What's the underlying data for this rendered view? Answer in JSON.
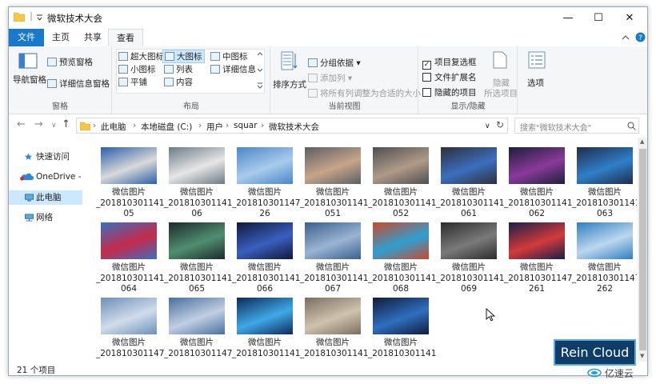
{
  "window": {
    "title": "微软技术大会",
    "minimize": "—",
    "maximize": "☐",
    "close": "✕"
  },
  "ribbon_tabs": [
    "文件",
    "主页",
    "共享",
    "查看"
  ],
  "ribbon": {
    "pane_group": {
      "label": "窗格",
      "nav_pane": "导航窗格",
      "preview_pane": "预览窗格",
      "details_pane": "详细信息窗格"
    },
    "layout_group": {
      "label": "布局",
      "items": [
        "超大图标",
        "大图标",
        "中图标",
        "小图标",
        "列表",
        "详细信息",
        "平铺",
        "内容"
      ],
      "selected": "大图标"
    },
    "view_group": {
      "label": "当前视图",
      "sort": "排序方式",
      "group_by": "分组依据",
      "add_column": "添加列",
      "fit_columns": "将所有列调整为合适的大小"
    },
    "showhide_group": {
      "label": "显示/隐藏",
      "checkboxes": [
        {
          "label": "项目复选框",
          "checked": true
        },
        {
          "label": "文件扩展名",
          "checked": false
        },
        {
          "label": "隐藏的项目",
          "checked": false
        }
      ],
      "hide_selected_line1": "隐藏",
      "hide_selected_line2": "所选项目",
      "options": "选项"
    }
  },
  "address": {
    "crumbs": [
      "此电脑",
      "本地磁盘 (C:)",
      "用户",
      "squar",
      "微软技术大会"
    ],
    "search_placeholder": "搜索\"微软技术大会\""
  },
  "nav_pane": [
    {
      "label": "快速访问",
      "selected": false
    },
    {
      "label": "OneDrive -",
      "selected": false
    },
    {
      "label": "此电脑",
      "selected": true
    },
    {
      "label": "网络",
      "selected": false
    }
  ],
  "files": [
    {
      "line1": "微信图片",
      "line2": "_201810301141",
      "line3": "05",
      "colors": [
        "#2a5fa8",
        "#d9d9d9"
      ]
    },
    {
      "line1": "微信图片",
      "line2": "_201810301141",
      "line3": "06",
      "colors": [
        "#6b7b86",
        "#e6e6e6"
      ]
    },
    {
      "line1": "微信图片",
      "line2": "_201810301147",
      "line3": "26",
      "colors": [
        "#4a86c8",
        "#a9cbec"
      ]
    },
    {
      "line1": "微信图片",
      "line2": "_201810301141",
      "line3": "051",
      "colors": [
        "#5c5f63",
        "#c8a48a"
      ]
    },
    {
      "line1": "微信图片",
      "line2": "_201810301141",
      "line3": "052",
      "colors": [
        "#4d4f52",
        "#b09a88"
      ]
    },
    {
      "line1": "微信图片",
      "line2": "_201810301141",
      "line3": "061",
      "colors": [
        "#2f2f3a",
        "#3b6fbf"
      ]
    },
    {
      "line1": "微信图片",
      "line2": "_201810301141",
      "line3": "062",
      "colors": [
        "#1c1f3b",
        "#8a3a9a"
      ]
    },
    {
      "line1": "微信图片",
      "line2": "_201810301141",
      "line3": "063",
      "colors": [
        "#1f2d4a",
        "#2f7fc9"
      ]
    },
    {
      "line1": "微信图片",
      "line2": "_201810301141",
      "line3": "064",
      "colors": [
        "#3a6fbf",
        "#c52b4a"
      ]
    },
    {
      "line1": "微信图片",
      "line2": "_201810301141",
      "line3": "065",
      "colors": [
        "#1c2a2e",
        "#4f8f6f"
      ]
    },
    {
      "line1": "微信图片",
      "line2": "_201810301141",
      "line3": "066",
      "colors": [
        "#101a3a",
        "#3a5fbf"
      ]
    },
    {
      "line1": "微信图片",
      "line2": "_201810301141",
      "line3": "067",
      "colors": [
        "#3a5f8f",
        "#9ab4d2"
      ]
    },
    {
      "line1": "微信图片",
      "line2": "_201810301141",
      "line3": "068",
      "colors": [
        "#c84a2a",
        "#2f9fd2"
      ]
    },
    {
      "line1": "微信图片",
      "line2": "_201810301141",
      "line3": "069",
      "colors": [
        "#2c2c2c",
        "#7a7a7a"
      ]
    },
    {
      "line1": "微信图片",
      "line2": "_201810301147",
      "line3": "261",
      "colors": [
        "#1a1f4a",
        "#d23a3a"
      ]
    },
    {
      "line1": "微信图片",
      "line2": "_201810301147",
      "line3": "262",
      "colors": [
        "#2f7fbf",
        "#bcd7ee"
      ]
    },
    {
      "line1": "微信图片",
      "line2": "_201810301147",
      "line3": "",
      "colors": [
        "#6f8fb8",
        "#d0dceb"
      ]
    },
    {
      "line1": "微信图片",
      "line2": "_201810301147",
      "line3": "",
      "colors": [
        "#4a6fa0",
        "#c0cfe2"
      ]
    },
    {
      "line1": "微信图片",
      "line2": "_201810301141",
      "line3": "",
      "colors": [
        "#0c2a5a",
        "#3fa9e6"
      ]
    },
    {
      "line1": "微信图片",
      "line2": "_201810301141",
      "line3": "",
      "colors": [
        "#7a6f5f",
        "#cfc2ae"
      ]
    },
    {
      "line1": "微信图片",
      "line2": "_201810301141",
      "line3": "",
      "colors": [
        "#101c3a",
        "#2f6fbf"
      ]
    }
  ],
  "status": {
    "item_count": "21 个项目"
  },
  "watermark": {
    "label": "Rein Cloud",
    "brand": "亿速云"
  },
  "colors": {
    "accent": "#1979ca",
    "selection": "#cce8ff"
  }
}
